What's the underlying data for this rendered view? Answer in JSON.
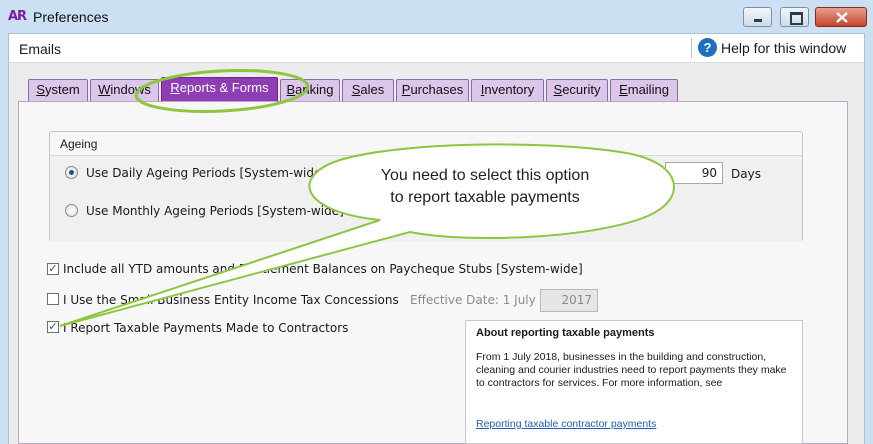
{
  "window": {
    "logo": "AR",
    "title": "Preferences"
  },
  "header": {
    "section": "Emails",
    "help_label": "Help for this window",
    "help_icon": "help-icon"
  },
  "tabs": [
    {
      "label": "System",
      "ul": "S",
      "rest": "ystem"
    },
    {
      "label": "Windows",
      "ul": "W",
      "rest": "indows"
    },
    {
      "label": "Reports & Forms",
      "ul": "R",
      "rest": "eports & Forms",
      "active": true
    },
    {
      "label": "Banking",
      "ul": "B",
      "rest": "anking"
    },
    {
      "label": "Sales",
      "ul": "S",
      "rest": "ales"
    },
    {
      "label": "Purchases",
      "ul": "P",
      "rest": "urchases"
    },
    {
      "label": "Inventory",
      "ul": "I",
      "rest": "nventory"
    },
    {
      "label": "Security",
      "ul": "S",
      "rest": "ecurity"
    },
    {
      "label": "Emailing",
      "ul": "E",
      "rest": "mailing"
    }
  ],
  "ageing": {
    "title": "Ageing",
    "daily_label": "Use Daily Ageing Periods [System-wide]",
    "monthly_label": "Use Monthly Ageing Periods [System-wide]",
    "days_value": "90",
    "days_label": "Days",
    "selected": "daily"
  },
  "options": {
    "ytd_label": "Include all YTD amounts and Entitlement Balances on Paycheque Stubs [System-wide]",
    "ytd_checked": true,
    "sbe_label": "I Use the Small Business Entity Income Tax Concessions",
    "sbe_checked": false,
    "effective_label": "Effective Date: 1 July",
    "effective_value": "2017",
    "tpar_label": "I Report Taxable Payments Made to Contractors",
    "tpar_checked": true
  },
  "about": {
    "title": "About reporting taxable payments",
    "body": "From 1 July 2018, businesses in the building and construction, cleaning and courier industries need to report payments they make to contractors for services. For more information, see",
    "link": "Reporting taxable contractor payments"
  },
  "callout": {
    "line1": "You need to select this option",
    "line2": "to report taxable payments",
    "color": "#8dc63f"
  }
}
